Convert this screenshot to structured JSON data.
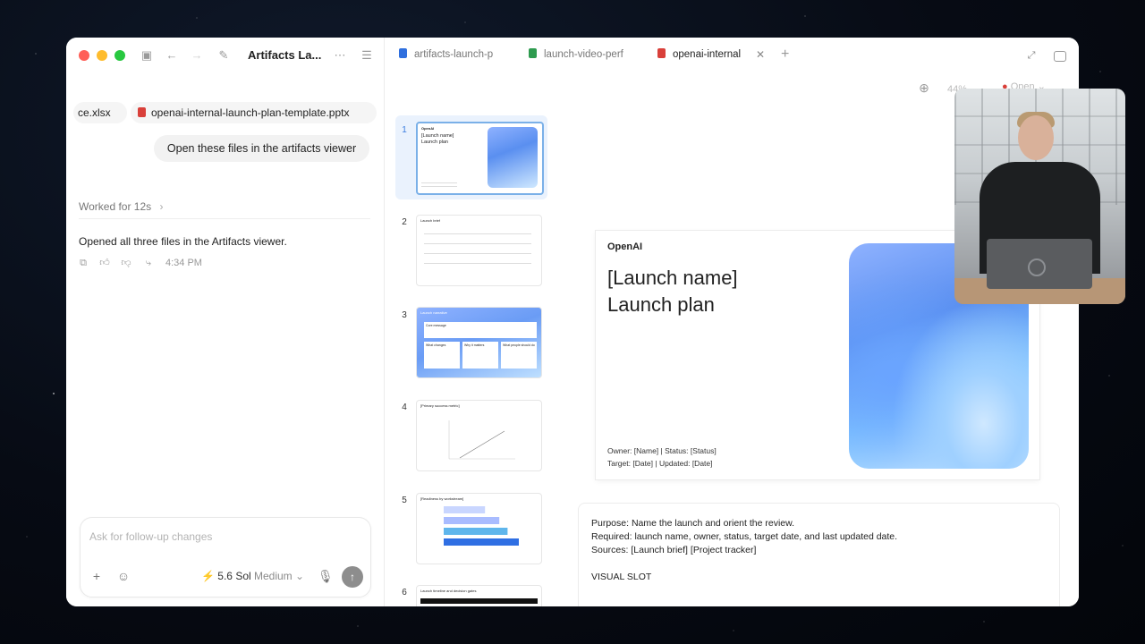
{
  "left": {
    "window_title": "Artifacts La...",
    "attachments": [
      {
        "label": "ce.xlsx"
      },
      {
        "label": "openai-internal-launch-plan-template.pptx"
      }
    ],
    "user_message": "Open these files in the artifacts viewer",
    "worked_label": "Worked for 12s",
    "assistant_message": "Opened all three files in the Artifacts viewer.",
    "message_time": "4:34 PM",
    "composer": {
      "placeholder": "Ask for follow-up changes",
      "model_name": "5.6 Sol",
      "effort": "Medium"
    }
  },
  "right": {
    "tabs": [
      {
        "label": "artifacts-launch-p",
        "icon": "doc-icon",
        "color": "#2f6fde"
      },
      {
        "label": "launch-video-perf",
        "icon": "sheet-icon",
        "color": "#2e9b4f"
      },
      {
        "label": "openai-internal",
        "icon": "slides-icon",
        "color": "#d9403a"
      }
    ],
    "zoom": "44%",
    "open_label": "Open",
    "slide_numbers": [
      "1",
      "2",
      "3",
      "4",
      "5",
      "6"
    ],
    "thumb_texts": {
      "t1_logo": "OpenAI",
      "t1_title": "[Launch name] Launch plan",
      "t2_title": "Launch brief",
      "t3_title": "Launch narrative",
      "t3_core": "Core message",
      "t3_cols": [
        "What changes",
        "Why it matters",
        "What people should do"
      ],
      "t4_title": "[Primary success metric]",
      "t5_title": "[Readiness by workstream]",
      "t6_title": "Launch timeline and decision gates"
    },
    "readiness_bars": [
      0.55,
      0.74,
      0.85,
      1.0
    ],
    "slide": {
      "logo": "OpenAI",
      "title_line1": "[Launch name]",
      "title_line2": "Launch plan",
      "meta_line1": "Owner: [Name]  |  Status: [Status]",
      "meta_line2": "Target: [Date]  |  Updated: [Date]"
    },
    "notes": {
      "purpose": "Purpose: Name the launch and orient the review.",
      "required": "Required: launch name, owner, status, target date, and last updated date.",
      "sources": "Sources: [Launch brief] [Project tracker]",
      "visual_slot": "VISUAL SLOT"
    }
  }
}
